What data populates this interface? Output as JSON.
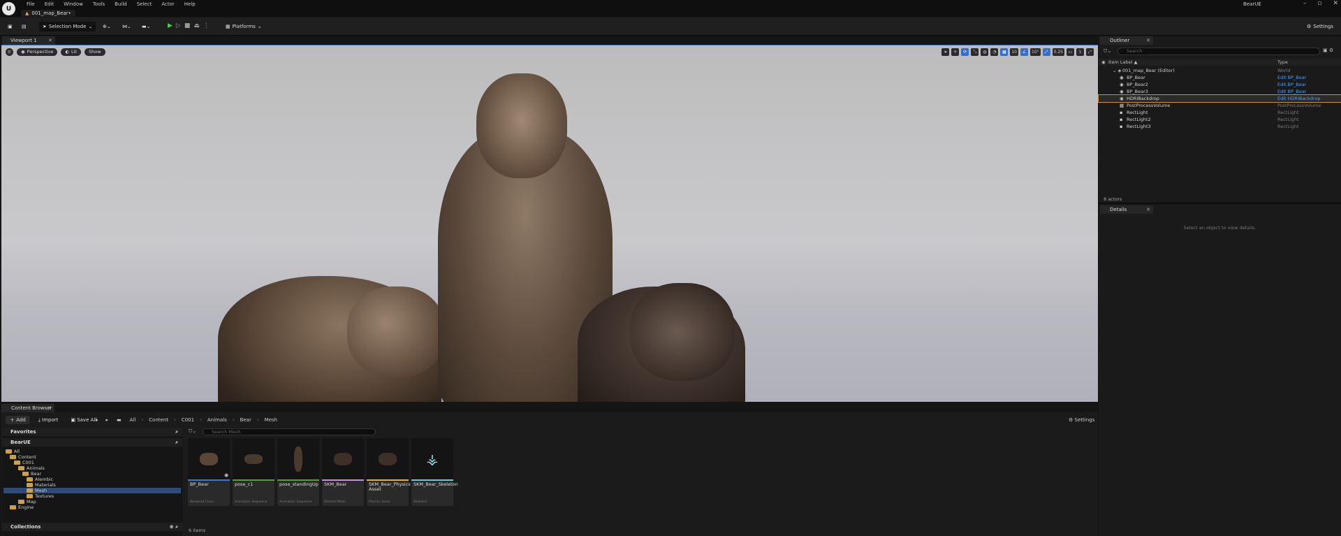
{
  "app": {
    "logo_text": "U",
    "title": "BearUE",
    "map_tab": "001_map_Bear•",
    "window_controls": [
      "–",
      "▫",
      "✕"
    ]
  },
  "menu": [
    "File",
    "Edit",
    "Window",
    "Tools",
    "Build",
    "Select",
    "Actor",
    "Help"
  ],
  "toolbar": {
    "selection_mode": "Selection Mode",
    "platforms": "Platforms",
    "settings": "Settings"
  },
  "viewport": {
    "tab": "Viewport 1",
    "perspective": "Perspective",
    "lit": "Lit",
    "show": "Show",
    "grid_snap": "10",
    "rot_snap": "10°",
    "scale_snap": "0.25",
    "camera_speed": "1"
  },
  "outliner": {
    "tab": "Outliner",
    "search_placeholder": "Search",
    "col_label": "Item Label ▲",
    "col_type": "Type",
    "rows": [
      {
        "label": "001_map_Bear (Editor)",
        "type": "World",
        "link": false
      },
      {
        "label": "BP_Bear",
        "type": "Edit BP_Bear",
        "link": true
      },
      {
        "label": "BP_Bear2",
        "type": "Edit BP_Bear",
        "link": true
      },
      {
        "label": "BP_Bear3",
        "type": "Edit BP_Bear",
        "link": true
      },
      {
        "label": "HDRIBackdrop",
        "type": "Edit HDRIBackdrop",
        "link": true
      },
      {
        "label": "PostProcessVolume",
        "type": "PostProcessVolume",
        "link": false
      },
      {
        "label": "RectLight",
        "type": "RectLight",
        "link": false
      },
      {
        "label": "RectLight2",
        "type": "RectLight",
        "link": false
      },
      {
        "label": "RectLight3",
        "type": "RectLight",
        "link": false
      }
    ],
    "actor_count": "8 actors"
  },
  "details": {
    "tab": "Details",
    "empty_message": "Select an object to view details."
  },
  "content_browser": {
    "tab": "Content Browser",
    "add": "Add",
    "import": "Import",
    "save_all": "Save All",
    "breadcrumbs": [
      "All",
      "Content",
      "C001",
      "Animals",
      "Bear",
      "Mesh"
    ],
    "settings": "Settings",
    "search_placeholder": "Search Mesh",
    "favorites": "Favorites",
    "project": "BearUE",
    "collections": "Collections",
    "tree": [
      "All",
      "Content",
      "C001",
      "Animals",
      "Bear",
      "Alembic",
      "Materials",
      "Mesh",
      "Textures",
      "Map",
      "Engine"
    ],
    "assets": [
      {
        "name": "BP_Bear",
        "kind": "Blueprint Class",
        "color": "#3a78d8"
      },
      {
        "name": "pose_c1",
        "kind": "Animation Sequence",
        "color": "#59a03a"
      },
      {
        "name": "pose_standingUp",
        "kind": "Animation Sequence",
        "color": "#59a03a"
      },
      {
        "name": "SKM_Bear",
        "kind": "Skeletal Mesh",
        "color": "#c890e0"
      },
      {
        "name": "SKM_Bear_Physics Asset",
        "kind": "Physics Asset",
        "color": "#e0b040"
      },
      {
        "name": "SKM_Bear_Skeleton",
        "kind": "Skeleton",
        "color": "#6ac8d8"
      }
    ],
    "item_count": "6 items"
  }
}
